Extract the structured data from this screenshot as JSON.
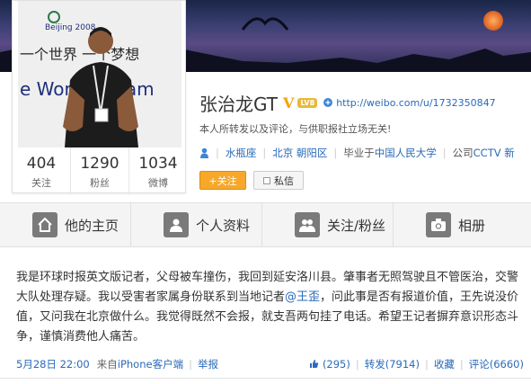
{
  "profile": {
    "name": "张治龙GT",
    "verified_mark": "V",
    "level_badge": "LV8",
    "url": "http://weibo.com/u/1732350847",
    "description": "本人所转发以及评论，与供职报社立场无关!",
    "zodiac": "水瓶座",
    "location": "北京 朝阳区",
    "education_prefix": "毕业于",
    "education": "中国人民大学",
    "company_prefix": "公司",
    "company": "CCTV 新"
  },
  "stats": [
    {
      "value": "404",
      "label": "关注"
    },
    {
      "value": "1290",
      "label": "粉丝"
    },
    {
      "value": "1034",
      "label": "微博"
    }
  ],
  "buttons": {
    "follow": "+关注",
    "message": "私信"
  },
  "nav": [
    {
      "label": "他的主页",
      "icon": "home-icon"
    },
    {
      "label": "个人资料",
      "icon": "person-icon"
    },
    {
      "label": "关注/粉丝",
      "icon": "people-icon"
    },
    {
      "label": "相册",
      "icon": "camera-icon"
    }
  ],
  "post": {
    "text_before": "我是环球时报英文版记者，父母被车撞伤，我回到延安洛川县。肇事者无照驾驶且不管医治，交警大队处理存疑。我以受害者家属身份联系到当地记者",
    "mention": "@王歪",
    "text_after": "，问此事是否有报道价值，王先说没价值，又问我在北京做什么。我觉得既然不会报，就支吾两句挂了电话。希望王记者摒弃意识形态斗争，谨慎消费他人痛苦。",
    "time": "5月28日 22:00",
    "source_prefix": "来自",
    "source": "iPhone客户端",
    "report": "举报",
    "likes": "(295)",
    "repost": "转发(7914)",
    "favorite": "收藏",
    "comment": "评论(6660)"
  },
  "colors": {
    "accent": "#2a6ab8",
    "follow_button": "#f7a82a",
    "verified": "#f5a300"
  }
}
